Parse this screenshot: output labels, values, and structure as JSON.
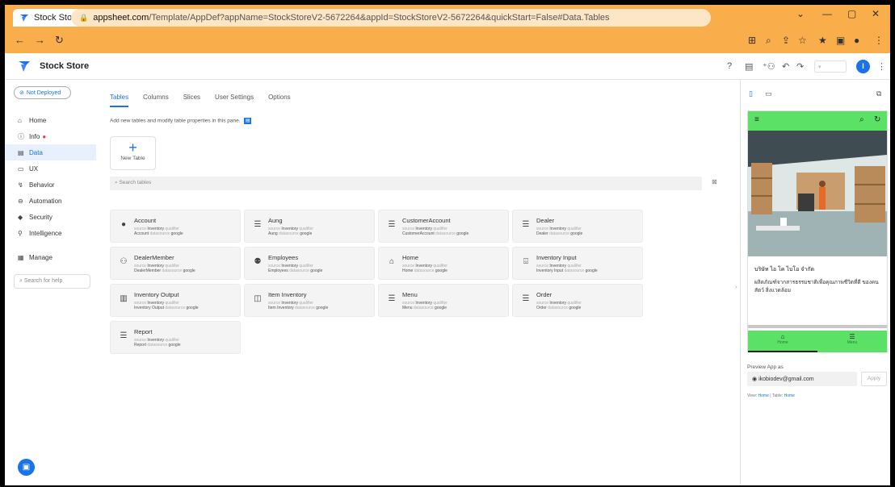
{
  "browser": {
    "tab_title": "Stock Store - AppSheet",
    "url_host": "appsheet.com",
    "url_path": "/Template/AppDef?appName=StockStoreV2-5672264&appId=StockStoreV2-5672264&quickStart=False#Data.Tables",
    "colors": {
      "frame": "#f9ad4b",
      "omnibox": "#fde6c6"
    }
  },
  "app": {
    "name": "Stock Store",
    "user_initial": "I",
    "accent": "#1a73e8"
  },
  "sidebar": {
    "deploy_status": "Not Deployed",
    "items": [
      {
        "label": "Home",
        "icon": "home-icon"
      },
      {
        "label": "Info",
        "icon": "info-icon"
      },
      {
        "label": "Data",
        "icon": "data-icon"
      },
      {
        "label": "UX",
        "icon": "ux-icon"
      },
      {
        "label": "Behavior",
        "icon": "behavior-icon"
      },
      {
        "label": "Automation",
        "icon": "automation-icon"
      },
      {
        "label": "Security",
        "icon": "security-icon"
      },
      {
        "label": "Intelligence",
        "icon": "intelligence-icon"
      },
      {
        "label": "Manage",
        "icon": "manage-icon"
      }
    ],
    "search_help_placeholder": "Search for help"
  },
  "main": {
    "tabs": [
      "Tables",
      "Columns",
      "Slices",
      "User Settings",
      "Options"
    ],
    "info_text": "Add new tables and modify table properties in this pane.",
    "new_table_label": "New Table",
    "search_placeholder": "Search tables",
    "tables": [
      {
        "name": "Account",
        "source": "Inventory",
        "qualifier": "Account",
        "icon": "person-icon"
      },
      {
        "name": "Aung",
        "source": "Inventory",
        "qualifier": "Aung",
        "icon": "list-icon"
      },
      {
        "name": "CustomerAccount",
        "source": "Inventory",
        "qualifier": "CustomerAccount",
        "icon": "list-icon"
      },
      {
        "name": "Dealer",
        "source": "Inventory",
        "qualifier": "Dealer",
        "icon": "list-icon"
      },
      {
        "name": "DealerMember",
        "source": "Inventory",
        "qualifier": "DealerMember",
        "icon": "people-icon"
      },
      {
        "name": "Employees",
        "source": "Inventory",
        "qualifier": "Employees",
        "icon": "group-icon"
      },
      {
        "name": "Home",
        "source": "Inventory",
        "qualifier": "Home",
        "icon": "house-icon"
      },
      {
        "name": "Inventory Input",
        "source": "Inventory",
        "qualifier": "Inventory Input",
        "icon": "store-icon"
      },
      {
        "name": "Inventory Output",
        "source": "Inventory",
        "qualifier": "Inventory Output",
        "icon": "building-icon"
      },
      {
        "name": "Item Inventory",
        "source": "Inventory",
        "qualifier": "Item Inventory",
        "icon": "shop-icon"
      },
      {
        "name": "Menu",
        "source": "Inventory",
        "qualifier": "Menu",
        "icon": "list-icon"
      },
      {
        "name": "Order",
        "source": "Inventory",
        "qualifier": "Order",
        "icon": "list-icon"
      },
      {
        "name": "Report",
        "source": "Inventory",
        "qualifier": "Report",
        "icon": "list-icon"
      }
    ],
    "meta_labels": {
      "source": "source",
      "qualifier": "qualifier",
      "datasource": "datasource",
      "datasource_value": "google"
    }
  },
  "preview": {
    "company_line": "บริษัท ไอ โค ไบโอ จำกัด",
    "description": "ผลิตภัณฑ์จากสารธรรมชาติเพื่อคุณภาพชีวิตที่ดี ของคน สัตว์ สิ่งแวดล้อม",
    "nav": [
      {
        "label": "Home",
        "icon": "house-icon"
      },
      {
        "label": "Menu",
        "icon": "list-icon"
      }
    ],
    "preview_as_label": "Preview App as",
    "email": "ikobiodev@gmail.com",
    "apply_label": "Apply",
    "view_label": "View:",
    "view_value": "Home",
    "table_label": "Table:",
    "table_value": "Home",
    "bar_color": "#5ae166"
  }
}
